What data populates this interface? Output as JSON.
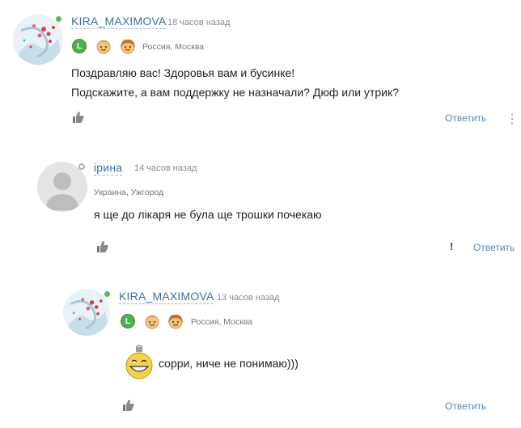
{
  "comments": [
    {
      "username": "KIRA_MAXIMOVA",
      "time": "18 часов назад",
      "badge_letter": "L",
      "location": "Россия, Москва",
      "lines": [
        "Поздравляю вас! Здоровья вам и бусинке!",
        "Подскажите, а вам поддержку не назначали? Дюф или утрик?"
      ],
      "reply_label": "Ответить",
      "more_label": "⋮",
      "online": true
    },
    {
      "username": "ірина",
      "time": "14 часов назад",
      "location": "Украина, Ужгород",
      "lines": [
        "я ще до лікаря не була ще трошки почекаю"
      ],
      "report_label": "!",
      "reply_label": "Ответить",
      "online": false
    },
    {
      "username": "KIRA_MAXIMOVA",
      "time": "13 часов назад",
      "badge_letter": "L",
      "location": "Россия, Москва",
      "lines": [
        "сорри, ниче не понимаю)))"
      ],
      "reply_label": "Ответить",
      "emoticon": "grinning-ornament-smiley",
      "online": true
    }
  ],
  "colors": {
    "username": "#3f6ea5",
    "reply": "#5a86b9",
    "online": "#5cb85c",
    "badge": "#4caf50"
  }
}
